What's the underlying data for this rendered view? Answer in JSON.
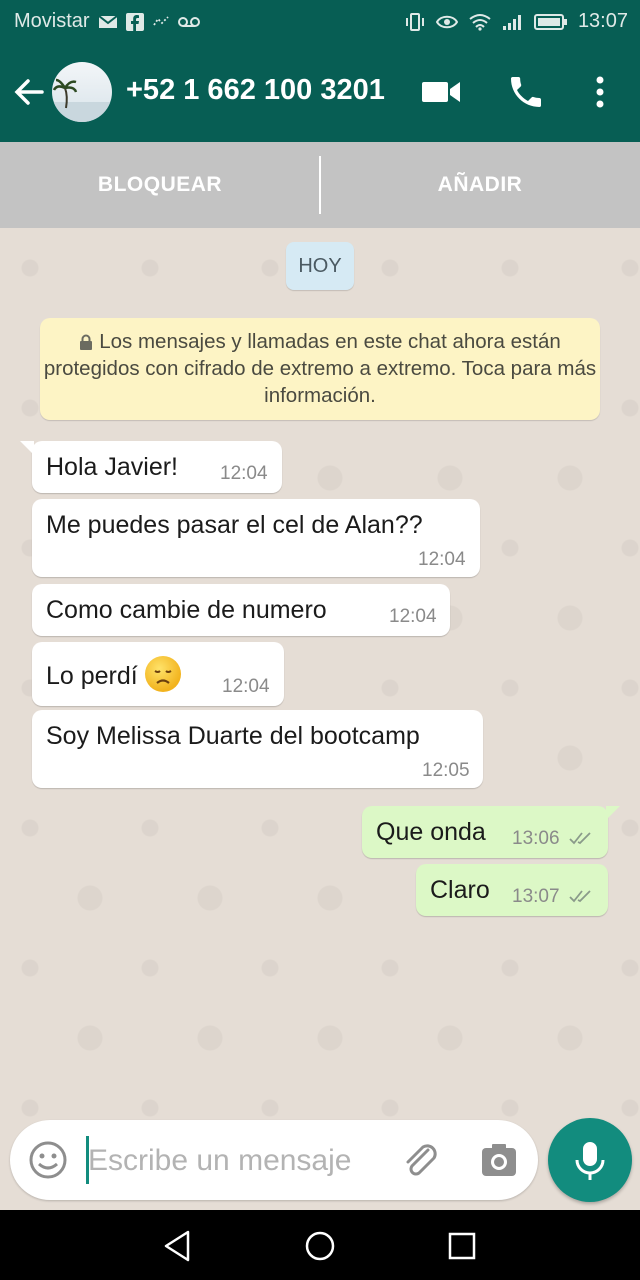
{
  "status_bar": {
    "carrier": "Movistar",
    "time": "13:07"
  },
  "header": {
    "contact": "+52 1 662 100 3201",
    "back_icon": "arrow-left-icon",
    "video_icon": "video-camera-icon",
    "call_icon": "phone-icon",
    "menu_icon": "more-vert-icon"
  },
  "actions": {
    "block_label": "BLOQUEAR",
    "add_label": "AÑADIR"
  },
  "chat": {
    "date_chip": "HOY",
    "encryption_notice": "Los mensajes y llamadas en este chat ahora están protegidos con cifrado de extremo a extremo. Toca para más información.",
    "messages": [
      {
        "direction": "in",
        "text": "Hola Javier!",
        "time": "12:04"
      },
      {
        "direction": "in",
        "text": "Me puedes pasar el cel de Alan??",
        "time": "12:04"
      },
      {
        "direction": "in",
        "text": "Como cambie de numero",
        "time": "12:04"
      },
      {
        "direction": "in",
        "text": "Lo perdí",
        "emoji": "disappointed-face",
        "time": "12:04"
      },
      {
        "direction": "in",
        "text": "Soy Melissa Duarte del bootcamp",
        "time": "12:05"
      },
      {
        "direction": "out",
        "text": "Que onda",
        "time": "13:06",
        "status": "delivered"
      },
      {
        "direction": "out",
        "text": "Claro",
        "time": "13:07",
        "status": "delivered"
      }
    ]
  },
  "composer": {
    "placeholder": "Escribe un mensaje",
    "value": ""
  },
  "colors": {
    "header": "#075e54",
    "accent": "#128c7e",
    "outgoing_bubble": "#dcf8c6",
    "notice_bg": "#fdf4c5",
    "chat_bg": "#e5ddd5"
  }
}
